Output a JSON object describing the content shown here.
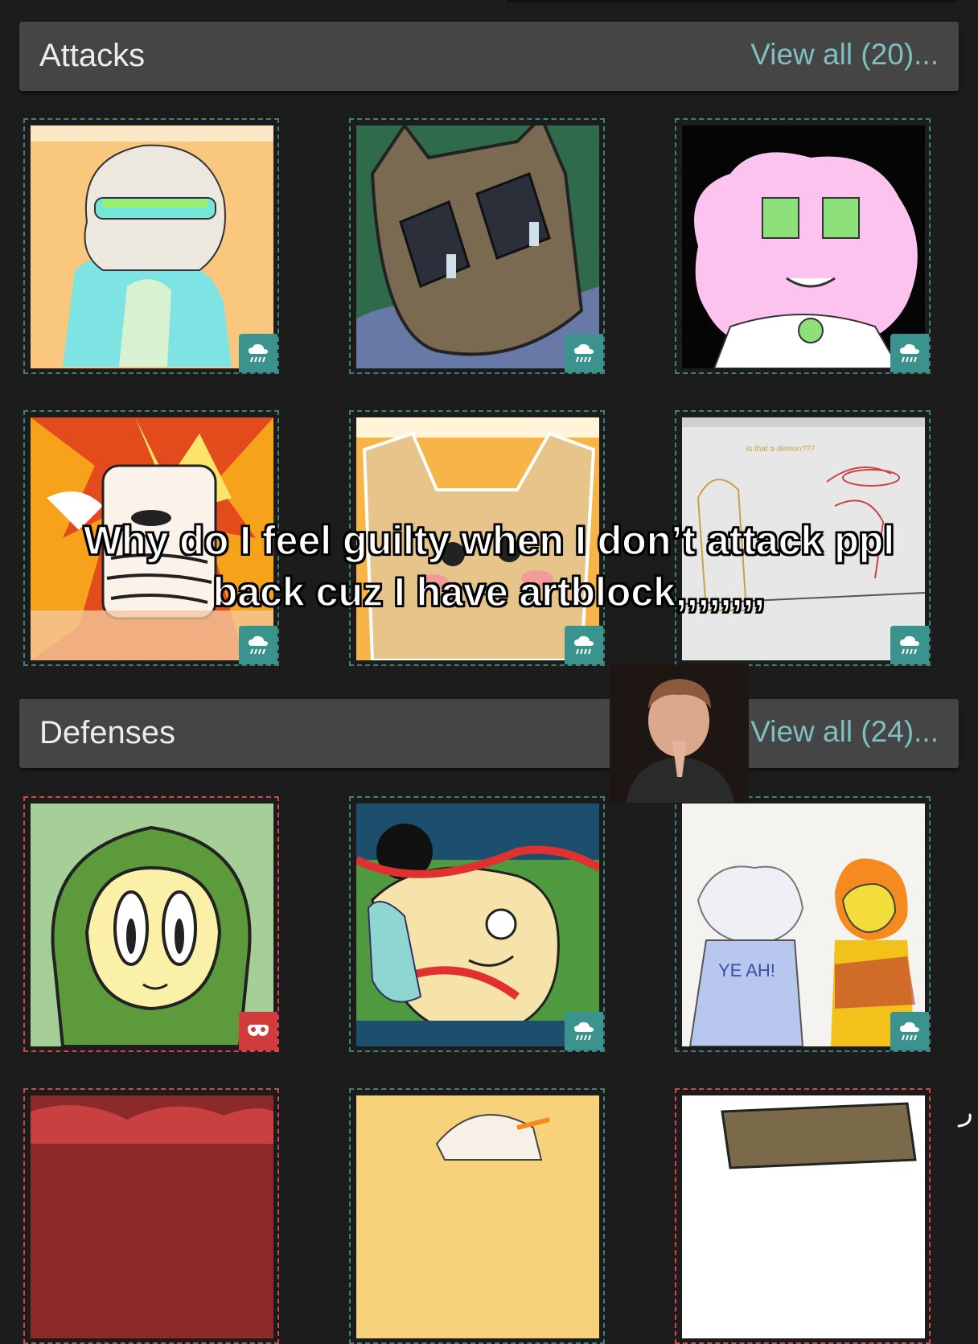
{
  "attacks": {
    "title": "Attacks",
    "view_all": "View all (20)..."
  },
  "defenses": {
    "title": "Defenses",
    "view_all": "View all (24)..."
  },
  "caption": {
    "line1": "Why do I feel guilty when I don’t attack ppl",
    "line2": "back cuz I have artblock,,,,,,,,"
  },
  "art_text": {
    "demon_note": "is that a demon???",
    "yeah": "YE AH!"
  },
  "badges": {
    "attack_icon": "rain-cloud-icon",
    "defense_icon": "mask-icon"
  },
  "colors": {
    "accent": "#7fbfbf",
    "badge_teal": "#3a938d",
    "badge_red": "#d23b3b",
    "header_bg": "#454545",
    "page_bg": "#1c1c1c"
  }
}
